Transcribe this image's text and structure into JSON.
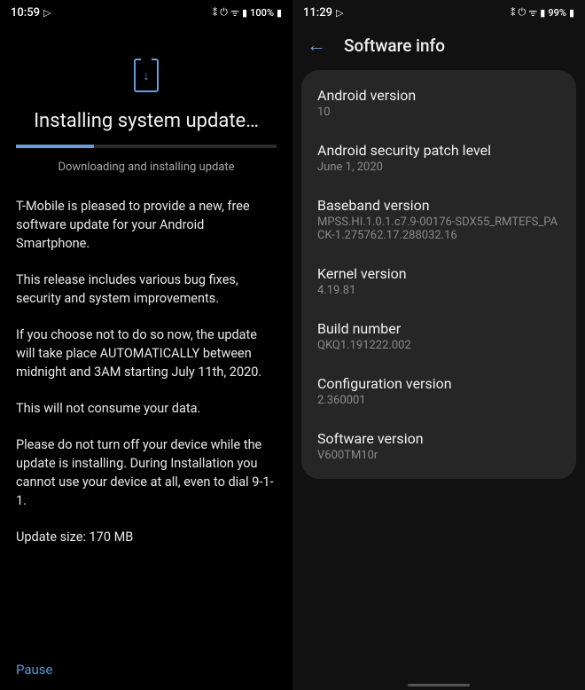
{
  "left": {
    "status": {
      "time": "10:59",
      "play_icon": "▷",
      "bt_icon": "⁑",
      "vibrate_icon": "⏻",
      "data_icon": "ᯤ",
      "signal_icon": "▮",
      "battery_pct": "100%",
      "battery_icon": "▮"
    },
    "title": "Installing system update…",
    "progress_label": "Downloading and installing update",
    "body": {
      "p1": "T-Mobile is pleased to provide a new, free software update for your Android Smartphone.",
      "p2": "This release includes various bug fixes, security and system improvements.",
      "p3": "If you choose not to do so now, the update will take place AUTOMATICALLY between midnight and 3AM starting July 11th, 2020.",
      "p4": "This will not consume your data.",
      "p5": "Please do not turn off your device while the update is installing. During Installation you cannot use your device at all, even to dial 9-1-1."
    },
    "size": "Update size: 170 MB",
    "pause": "Pause"
  },
  "right": {
    "status": {
      "time": "11:29",
      "play_icon": "▷",
      "bt_icon": "⁑",
      "vibrate_icon": "⏻",
      "data_icon": "ᯤ",
      "signal_icon": "▮",
      "battery_pct": "99%",
      "battery_icon": "▮"
    },
    "header": "Software info",
    "rows": [
      {
        "label": "Android version",
        "value": "10"
      },
      {
        "label": "Android security patch level",
        "value": "June 1, 2020"
      },
      {
        "label": "Baseband version",
        "value": "MPSS.HI.1.0.1.c7.9-00176-SDX55_RMTEFS_PACK-1.275762.17.288032.16"
      },
      {
        "label": "Kernel version",
        "value": "4.19.81"
      },
      {
        "label": "Build number",
        "value": "QKQ1.191222.002"
      },
      {
        "label": "Configuration version",
        "value": "2.360001"
      },
      {
        "label": "Software version",
        "value": "V600TM10r"
      }
    ]
  }
}
